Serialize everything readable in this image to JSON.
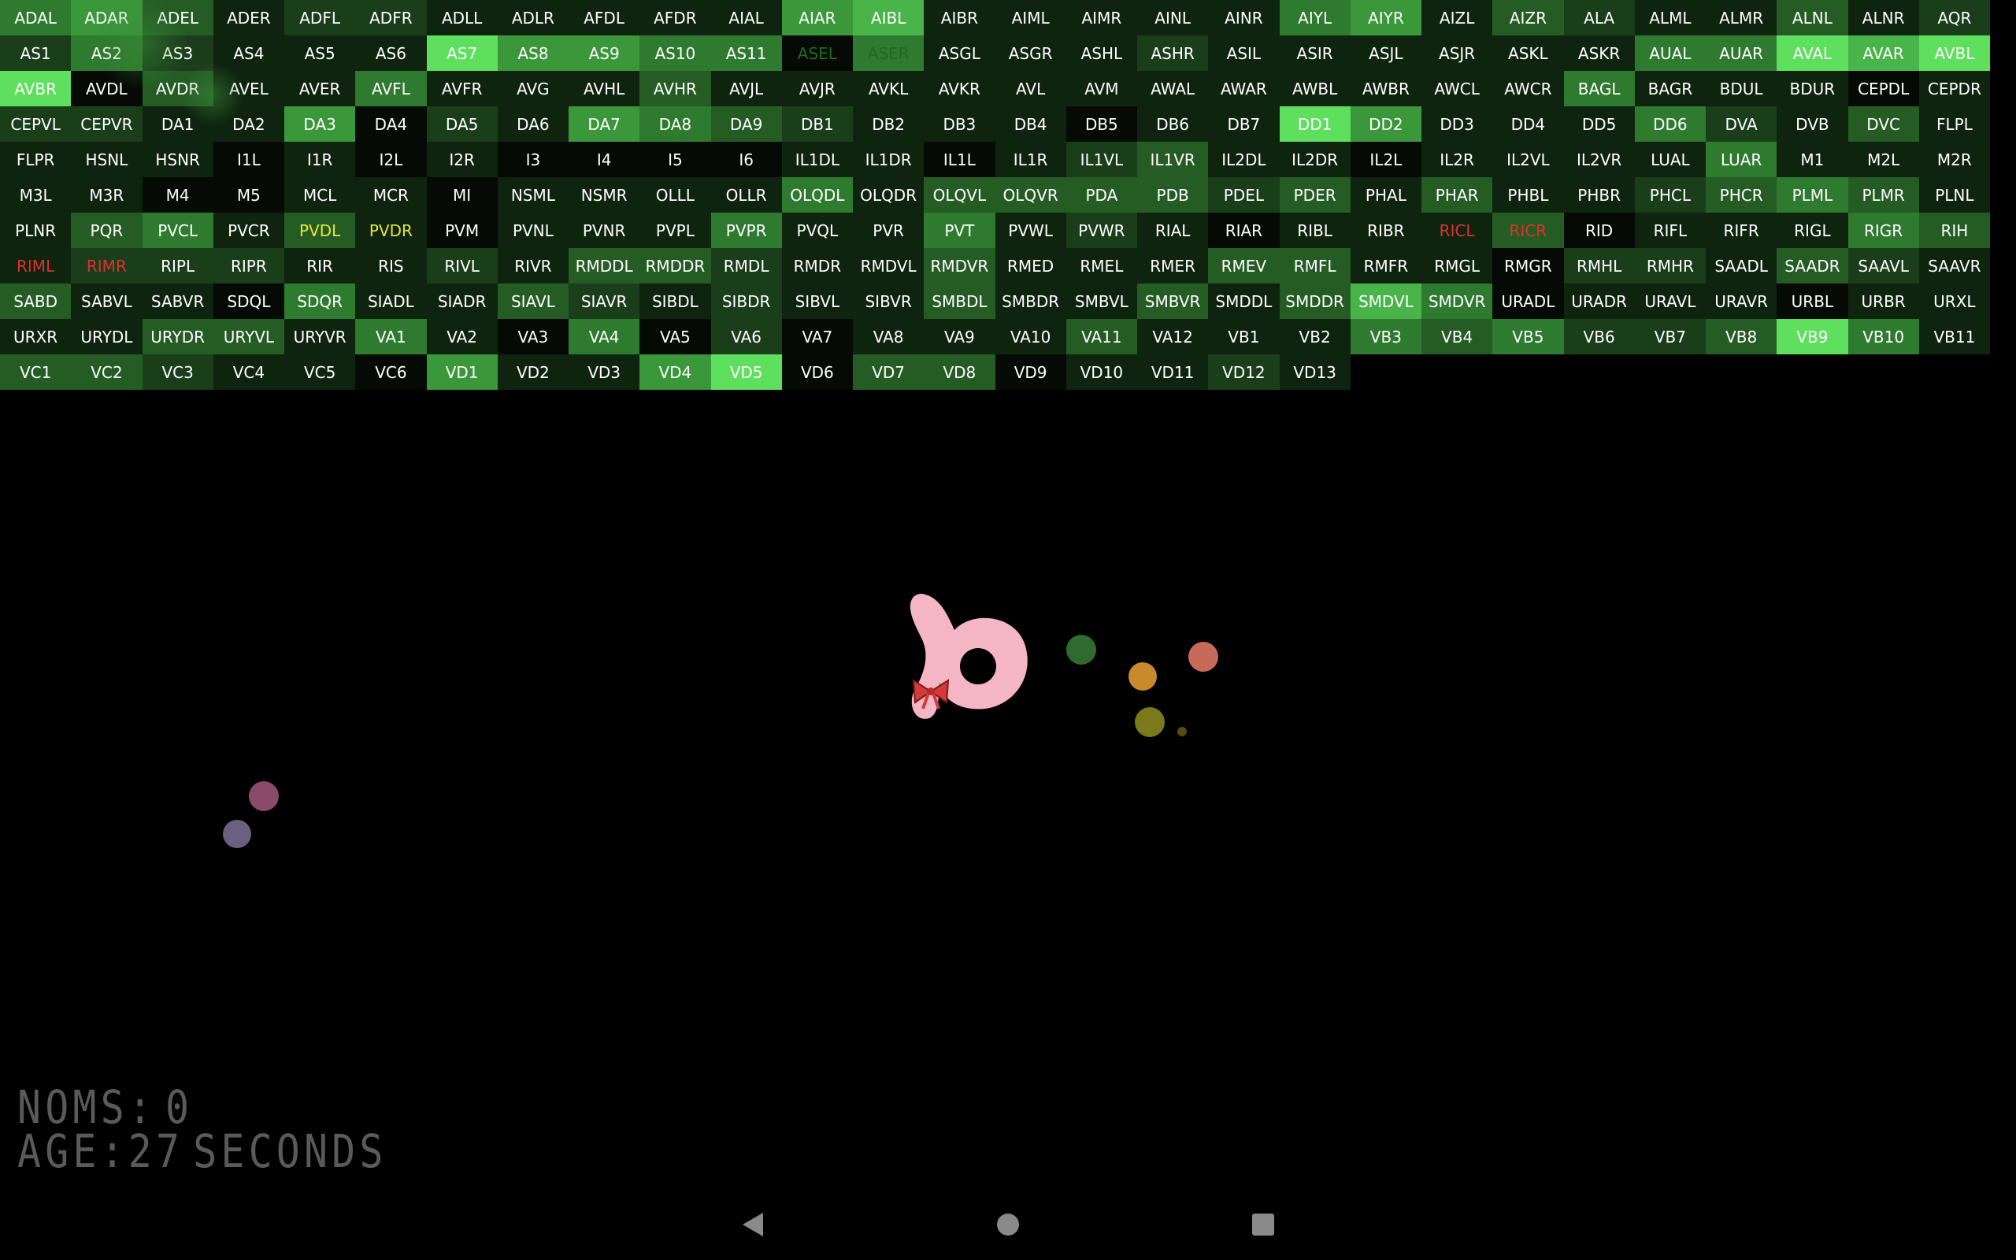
{
  "colors": {
    "g0": "#050a05",
    "g1": "#0f240f",
    "g2": "#1a3d1a",
    "g3": "#245c24",
    "g4": "#2e7a2e",
    "g5": "#3a973a",
    "g6": "#49b449",
    "g7": "#5ee05e",
    "white_text": "#ffffff",
    "red_text": "#e03030",
    "yellow_text": "#e6e633",
    "dark_green_text": "#1f6b1f",
    "hud_text": "#5a5a5a",
    "worm_body": "#f4b6c4",
    "bow": "#d43a3a"
  },
  "neurons": [
    {
      "label": "ADAL",
      "shade": "g4"
    },
    {
      "label": "ADAR",
      "shade": "g5"
    },
    {
      "label": "ADEL",
      "shade": "g3"
    },
    {
      "label": "ADER",
      "shade": "g1"
    },
    {
      "label": "ADFL",
      "shade": "g2"
    },
    {
      "label": "ADFR",
      "shade": "g2"
    },
    {
      "label": "ADLL",
      "shade": "g1"
    },
    {
      "label": "ADLR",
      "shade": "g1"
    },
    {
      "label": "AFDL",
      "shade": "g1"
    },
    {
      "label": "AFDR",
      "shade": "g1"
    },
    {
      "label": "AIAL",
      "shade": "g1"
    },
    {
      "label": "AIAR",
      "shade": "g5"
    },
    {
      "label": "AIBL",
      "shade": "g6"
    },
    {
      "label": "AIBR",
      "shade": "g1"
    },
    {
      "label": "AIML",
      "shade": "g1"
    },
    {
      "label": "AIMR",
      "shade": "g1"
    },
    {
      "label": "AINL",
      "shade": "g1"
    },
    {
      "label": "AINR",
      "shade": "g1"
    },
    {
      "label": "AIYL",
      "shade": "g4"
    },
    {
      "label": "AIYR",
      "shade": "g5"
    },
    {
      "label": "AIZL",
      "shade": "g1"
    },
    {
      "label": "AIZR",
      "shade": "g3"
    },
    {
      "label": "ALA",
      "shade": "g2"
    },
    {
      "label": "ALML",
      "shade": "g1"
    },
    {
      "label": "ALMR",
      "shade": "g1"
    },
    {
      "label": "ALNL",
      "shade": "g3"
    },
    {
      "label": "ALNR",
      "shade": "g1"
    },
    {
      "label": "AQR",
      "shade": "g2"
    },
    {
      "label": "AS1",
      "shade": "g2"
    },
    {
      "label": "AS2",
      "shade": "g4"
    },
    {
      "label": "AS3",
      "shade": "g2"
    },
    {
      "label": "AS4",
      "shade": "g1"
    },
    {
      "label": "AS5",
      "shade": "g1"
    },
    {
      "label": "AS6",
      "shade": "g1"
    },
    {
      "label": "AS7",
      "shade": "g7"
    },
    {
      "label": "AS8",
      "shade": "g5"
    },
    {
      "label": "AS9",
      "shade": "g5"
    },
    {
      "label": "AS10",
      "shade": "g4"
    },
    {
      "label": "AS11",
      "shade": "g4"
    },
    {
      "label": "ASEL",
      "shade": "g0",
      "text": "dark_green_text"
    },
    {
      "label": "ASER",
      "shade": "g4",
      "text": "dark_green_text"
    },
    {
      "label": "ASGL",
      "shade": "g1"
    },
    {
      "label": "ASGR",
      "shade": "g1"
    },
    {
      "label": "ASHL",
      "shade": "g1"
    },
    {
      "label": "ASHR",
      "shade": "g2"
    },
    {
      "label": "ASIL",
      "shade": "g1"
    },
    {
      "label": "ASIR",
      "shade": "g1"
    },
    {
      "label": "ASJL",
      "shade": "g1"
    },
    {
      "label": "ASJR",
      "shade": "g1"
    },
    {
      "label": "ASKL",
      "shade": "g1"
    },
    {
      "label": "ASKR",
      "shade": "g1"
    },
    {
      "label": "AUAL",
      "shade": "g4"
    },
    {
      "label": "AUAR",
      "shade": "g4"
    },
    {
      "label": "AVAL",
      "shade": "g7"
    },
    {
      "label": "AVAR",
      "shade": "g6"
    },
    {
      "label": "AVBL",
      "shade": "g7"
    },
    {
      "label": "AVBR",
      "shade": "g7"
    },
    {
      "label": "AVDL",
      "shade": "g0"
    },
    {
      "label": "AVDR",
      "shade": "g3"
    },
    {
      "label": "AVEL",
      "shade": "g1"
    },
    {
      "label": "AVER",
      "shade": "g1"
    },
    {
      "label": "AVFL",
      "shade": "g4"
    },
    {
      "label": "AVFR",
      "shade": "g1"
    },
    {
      "label": "AVG",
      "shade": "g1"
    },
    {
      "label": "AVHL",
      "shade": "g1"
    },
    {
      "label": "AVHR",
      "shade": "g3"
    },
    {
      "label": "AVJL",
      "shade": "g1"
    },
    {
      "label": "AVJR",
      "shade": "g1"
    },
    {
      "label": "AVKL",
      "shade": "g1"
    },
    {
      "label": "AVKR",
      "shade": "g1"
    },
    {
      "label": "AVL",
      "shade": "g1"
    },
    {
      "label": "AVM",
      "shade": "g1"
    },
    {
      "label": "AWAL",
      "shade": "g1"
    },
    {
      "label": "AWAR",
      "shade": "g1"
    },
    {
      "label": "AWBL",
      "shade": "g1"
    },
    {
      "label": "AWBR",
      "shade": "g1"
    },
    {
      "label": "AWCL",
      "shade": "g1"
    },
    {
      "label": "AWCR",
      "shade": "g1"
    },
    {
      "label": "BAGL",
      "shade": "g4"
    },
    {
      "label": "BAGR",
      "shade": "g1"
    },
    {
      "label": "BDUL",
      "shade": "g1"
    },
    {
      "label": "BDUR",
      "shade": "g1"
    },
    {
      "label": "CEPDL",
      "shade": "g0"
    },
    {
      "label": "CEPDR",
      "shade": "g1"
    },
    {
      "label": "CEPVL",
      "shade": "g2"
    },
    {
      "label": "CEPVR",
      "shade": "g2"
    },
    {
      "label": "DA1",
      "shade": "g1"
    },
    {
      "label": "DA2",
      "shade": "g1"
    },
    {
      "label": "DA3",
      "shade": "g5"
    },
    {
      "label": "DA4",
      "shade": "g0"
    },
    {
      "label": "DA5",
      "shade": "g2"
    },
    {
      "label": "DA6",
      "shade": "g1"
    },
    {
      "label": "DA7",
      "shade": "g5"
    },
    {
      "label": "DA8",
      "shade": "g4"
    },
    {
      "label": "DA9",
      "shade": "g3"
    },
    {
      "label": "DB1",
      "shade": "g2"
    },
    {
      "label": "DB2",
      "shade": "g1"
    },
    {
      "label": "DB3",
      "shade": "g1"
    },
    {
      "label": "DB4",
      "shade": "g1"
    },
    {
      "label": "DB5",
      "shade": "g0"
    },
    {
      "label": "DB6",
      "shade": "g1"
    },
    {
      "label": "DB7",
      "shade": "g1"
    },
    {
      "label": "DD1",
      "shade": "g7"
    },
    {
      "label": "DD2",
      "shade": "g5"
    },
    {
      "label": "DD3",
      "shade": "g1"
    },
    {
      "label": "DD4",
      "shade": "g1"
    },
    {
      "label": "DD5",
      "shade": "g1"
    },
    {
      "label": "DD6",
      "shade": "g4"
    },
    {
      "label": "DVA",
      "shade": "g2"
    },
    {
      "label": "DVB",
      "shade": "g1"
    },
    {
      "label": "DVC",
      "shade": "g3"
    },
    {
      "label": "FLPL",
      "shade": "g1"
    },
    {
      "label": "FLPR",
      "shade": "g1"
    },
    {
      "label": "HSNL",
      "shade": "g1"
    },
    {
      "label": "HSNR",
      "shade": "g1"
    },
    {
      "label": "I1L",
      "shade": "g0"
    },
    {
      "label": "I1R",
      "shade": "g1"
    },
    {
      "label": "I2L",
      "shade": "g0"
    },
    {
      "label": "I2R",
      "shade": "g1"
    },
    {
      "label": "I3",
      "shade": "g0"
    },
    {
      "label": "I4",
      "shade": "g0"
    },
    {
      "label": "I5",
      "shade": "g0"
    },
    {
      "label": "I6",
      "shade": "g0"
    },
    {
      "label": "IL1DL",
      "shade": "g1"
    },
    {
      "label": "IL1DR",
      "shade": "g1"
    },
    {
      "label": "IL1L",
      "shade": "g0"
    },
    {
      "label": "IL1R",
      "shade": "g1"
    },
    {
      "label": "IL1VL",
      "shade": "g2"
    },
    {
      "label": "IL1VR",
      "shade": "g3"
    },
    {
      "label": "IL2DL",
      "shade": "g1"
    },
    {
      "label": "IL2DR",
      "shade": "g1"
    },
    {
      "label": "IL2L",
      "shade": "g0"
    },
    {
      "label": "IL2R",
      "shade": "g1"
    },
    {
      "label": "IL2VL",
      "shade": "g1"
    },
    {
      "label": "IL2VR",
      "shade": "g1"
    },
    {
      "label": "LUAL",
      "shade": "g1"
    },
    {
      "label": "LUAR",
      "shade": "g4"
    },
    {
      "label": "M1",
      "shade": "g1"
    },
    {
      "label": "M2L",
      "shade": "g1"
    },
    {
      "label": "M2R",
      "shade": "g1"
    },
    {
      "label": "M3L",
      "shade": "g1"
    },
    {
      "label": "M3R",
      "shade": "g1"
    },
    {
      "label": "M4",
      "shade": "g0"
    },
    {
      "label": "M5",
      "shade": "g0"
    },
    {
      "label": "MCL",
      "shade": "g1"
    },
    {
      "label": "MCR",
      "shade": "g1"
    },
    {
      "label": "MI",
      "shade": "g0"
    },
    {
      "label": "NSML",
      "shade": "g1"
    },
    {
      "label": "NSMR",
      "shade": "g1"
    },
    {
      "label": "OLLL",
      "shade": "g1"
    },
    {
      "label": "OLLR",
      "shade": "g1"
    },
    {
      "label": "OLQDL",
      "shade": "g4"
    },
    {
      "label": "OLQDR",
      "shade": "g1"
    },
    {
      "label": "OLQVL",
      "shade": "g3"
    },
    {
      "label": "OLQVR",
      "shade": "g3"
    },
    {
      "label": "PDA",
      "shade": "g3"
    },
    {
      "label": "PDB",
      "shade": "g3"
    },
    {
      "label": "PDEL",
      "shade": "g2"
    },
    {
      "label": "PDER",
      "shade": "g3"
    },
    {
      "label": "PHAL",
      "shade": "g1"
    },
    {
      "label": "PHAR",
      "shade": "g3"
    },
    {
      "label": "PHBL",
      "shade": "g1"
    },
    {
      "label": "PHBR",
      "shade": "g1"
    },
    {
      "label": "PHCL",
      "shade": "g2"
    },
    {
      "label": "PHCR",
      "shade": "g3"
    },
    {
      "label": "PLML",
      "shade": "g4"
    },
    {
      "label": "PLMR",
      "shade": "g3"
    },
    {
      "label": "PLNL",
      "shade": "g1"
    },
    {
      "label": "PLNR",
      "shade": "g1"
    },
    {
      "label": "PQR",
      "shade": "g3"
    },
    {
      "label": "PVCL",
      "shade": "g4"
    },
    {
      "label": "PVCR",
      "shade": "g1"
    },
    {
      "label": "PVDL",
      "shade": "g3",
      "text": "yellow_text"
    },
    {
      "label": "PVDR",
      "shade": "g1",
      "text": "yellow_text"
    },
    {
      "label": "PVM",
      "shade": "g0"
    },
    {
      "label": "PVNL",
      "shade": "g1"
    },
    {
      "label": "PVNR",
      "shade": "g1"
    },
    {
      "label": "PVPL",
      "shade": "g1"
    },
    {
      "label": "PVPR",
      "shade": "g4"
    },
    {
      "label": "PVQL",
      "shade": "g1"
    },
    {
      "label": "PVR",
      "shade": "g1"
    },
    {
      "label": "PVT",
      "shade": "g4"
    },
    {
      "label": "PVWL",
      "shade": "g1"
    },
    {
      "label": "PVWR",
      "shade": "g2"
    },
    {
      "label": "RIAL",
      "shade": "g1"
    },
    {
      "label": "RIAR",
      "shade": "g0"
    },
    {
      "label": "RIBL",
      "shade": "g1"
    },
    {
      "label": "RIBR",
      "shade": "g1"
    },
    {
      "label": "RICL",
      "shade": "g1",
      "text": "red_text"
    },
    {
      "label": "RICR",
      "shade": "g3",
      "text": "red_text"
    },
    {
      "label": "RID",
      "shade": "g0"
    },
    {
      "label": "RIFL",
      "shade": "g1"
    },
    {
      "label": "RIFR",
      "shade": "g1"
    },
    {
      "label": "RIGL",
      "shade": "g1"
    },
    {
      "label": "RIGR",
      "shade": "g4"
    },
    {
      "label": "RIH",
      "shade": "g3"
    },
    {
      "label": "RIML",
      "shade": "g1",
      "text": "red_text"
    },
    {
      "label": "RIMR",
      "shade": "g2",
      "text": "red_text"
    },
    {
      "label": "RIPL",
      "shade": "g2"
    },
    {
      "label": "RIPR",
      "shade": "g2"
    },
    {
      "label": "RIR",
      "shade": "g1"
    },
    {
      "label": "RIS",
      "shade": "g1"
    },
    {
      "label": "RIVL",
      "shade": "g2"
    },
    {
      "label": "RIVR",
      "shade": "g1"
    },
    {
      "label": "RMDDL",
      "shade": "g3"
    },
    {
      "label": "RMDDR",
      "shade": "g3"
    },
    {
      "label": "RMDL",
      "shade": "g2"
    },
    {
      "label": "RMDR",
      "shade": "g1"
    },
    {
      "label": "RMDVL",
      "shade": "g1"
    },
    {
      "label": "RMDVR",
      "shade": "g3"
    },
    {
      "label": "RMED",
      "shade": "g1"
    },
    {
      "label": "RMEL",
      "shade": "g1"
    },
    {
      "label": "RMER",
      "shade": "g1"
    },
    {
      "label": "RMEV",
      "shade": "g3"
    },
    {
      "label": "RMFL",
      "shade": "g3"
    },
    {
      "label": "RMFR",
      "shade": "g1"
    },
    {
      "label": "RMGL",
      "shade": "g1"
    },
    {
      "label": "RMGR",
      "shade": "g0"
    },
    {
      "label": "RMHL",
      "shade": "g2"
    },
    {
      "label": "RMHR",
      "shade": "g2"
    },
    {
      "label": "SAADL",
      "shade": "g1"
    },
    {
      "label": "SAADR",
      "shade": "g3"
    },
    {
      "label": "SAAVL",
      "shade": "g2"
    },
    {
      "label": "SAAVR",
      "shade": "g1"
    },
    {
      "label": "SABD",
      "shade": "g3"
    },
    {
      "label": "SABVL",
      "shade": "g1"
    },
    {
      "label": "SABVR",
      "shade": "g1"
    },
    {
      "label": "SDQL",
      "shade": "g0"
    },
    {
      "label": "SDQR",
      "shade": "g4"
    },
    {
      "label": "SIADL",
      "shade": "g1"
    },
    {
      "label": "SIADR",
      "shade": "g1"
    },
    {
      "label": "SIAVL",
      "shade": "g3"
    },
    {
      "label": "SIAVR",
      "shade": "g2"
    },
    {
      "label": "SIBDL",
      "shade": "g1"
    },
    {
      "label": "SIBDR",
      "shade": "g2"
    },
    {
      "label": "SIBVL",
      "shade": "g1"
    },
    {
      "label": "SIBVR",
      "shade": "g1"
    },
    {
      "label": "SMBDL",
      "shade": "g3"
    },
    {
      "label": "SMBDR",
      "shade": "g1"
    },
    {
      "label": "SMBVL",
      "shade": "g1"
    },
    {
      "label": "SMBVR",
      "shade": "g3"
    },
    {
      "label": "SMDDL",
      "shade": "g1"
    },
    {
      "label": "SMDDR",
      "shade": "g3"
    },
    {
      "label": "SMDVL",
      "shade": "g6"
    },
    {
      "label": "SMDVR",
      "shade": "g4"
    },
    {
      "label": "URADL",
      "shade": "g0"
    },
    {
      "label": "URADR",
      "shade": "g1"
    },
    {
      "label": "URAVL",
      "shade": "g1"
    },
    {
      "label": "URAVR",
      "shade": "g1"
    },
    {
      "label": "URBL",
      "shade": "g0"
    },
    {
      "label": "URBR",
      "shade": "g1"
    },
    {
      "label": "URXL",
      "shade": "g1"
    },
    {
      "label": "URXR",
      "shade": "g1"
    },
    {
      "label": "URYDL",
      "shade": "g1"
    },
    {
      "label": "URYDR",
      "shade": "g3"
    },
    {
      "label": "URYVL",
      "shade": "g3"
    },
    {
      "label": "URYVR",
      "shade": "g1"
    },
    {
      "label": "VA1",
      "shade": "g4"
    },
    {
      "label": "VA2",
      "shade": "g1"
    },
    {
      "label": "VA3",
      "shade": "g0"
    },
    {
      "label": "VA4",
      "shade": "g4"
    },
    {
      "label": "VA5",
      "shade": "g0"
    },
    {
      "label": "VA6",
      "shade": "g2"
    },
    {
      "label": "VA7",
      "shade": "g0"
    },
    {
      "label": "VA8",
      "shade": "g1"
    },
    {
      "label": "VA9",
      "shade": "g1"
    },
    {
      "label": "VA10",
      "shade": "g1"
    },
    {
      "label": "VA11",
      "shade": "g3"
    },
    {
      "label": "VA12",
      "shade": "g1"
    },
    {
      "label": "VB1",
      "shade": "g1"
    },
    {
      "label": "VB2",
      "shade": "g1"
    },
    {
      "label": "VB3",
      "shade": "g4"
    },
    {
      "label": "VB4",
      "shade": "g3"
    },
    {
      "label": "VB5",
      "shade": "g4"
    },
    {
      "label": "VB6",
      "shade": "g2"
    },
    {
      "label": "VB7",
      "shade": "g2"
    },
    {
      "label": "VB8",
      "shade": "g3"
    },
    {
      "label": "VB9",
      "shade": "g7"
    },
    {
      "label": "VB10",
      "shade": "g4"
    },
    {
      "label": "VB11",
      "shade": "g1"
    },
    {
      "label": "VC1",
      "shade": "g3"
    },
    {
      "label": "VC2",
      "shade": "g3"
    },
    {
      "label": "VC3",
      "shade": "g2"
    },
    {
      "label": "VC4",
      "shade": "g1"
    },
    {
      "label": "VC5",
      "shade": "g1"
    },
    {
      "label": "VC6",
      "shade": "g0"
    },
    {
      "label": "VD1",
      "shade": "g5"
    },
    {
      "label": "VD2",
      "shade": "g1"
    },
    {
      "label": "VD3",
      "shade": "g1"
    },
    {
      "label": "VD4",
      "shade": "g5"
    },
    {
      "label": "VD5",
      "shade": "g7"
    },
    {
      "label": "VD6",
      "shade": "g0"
    },
    {
      "label": "VD7",
      "shade": "g3"
    },
    {
      "label": "VD8",
      "shade": "g3"
    },
    {
      "label": "VD9",
      "shade": "g0"
    },
    {
      "label": "VD10",
      "shade": "g1"
    },
    {
      "label": "VD11",
      "shade": "g1"
    },
    {
      "label": "VD12",
      "shade": "g2"
    },
    {
      "label": "VD13",
      "shade": "g1"
    }
  ],
  "hud": {
    "noms_label": "NOMS:",
    "noms_value": "0",
    "age_label": "AGE:",
    "age_value": "27",
    "age_unit": "SECONDS"
  },
  "food_pellets": [
    {
      "color": "#2f6b2f",
      "name": "food-pellet-green"
    },
    {
      "color": "#c88a2a",
      "name": "food-pellet-orange"
    },
    {
      "color": "#c86a5a",
      "name": "food-pellet-salmon"
    },
    {
      "color": "#7a7a1a",
      "name": "food-pellet-olive"
    },
    {
      "color": "#5a4a10",
      "name": "food-pellet-small"
    },
    {
      "color": "#8a4a6a",
      "name": "food-pellet-mauve"
    },
    {
      "color": "#6a6080",
      "name": "food-pellet-grey"
    }
  ],
  "nav": {
    "back_icon": "triangle-left-icon",
    "home_icon": "circle-icon",
    "recents_icon": "square-icon"
  }
}
